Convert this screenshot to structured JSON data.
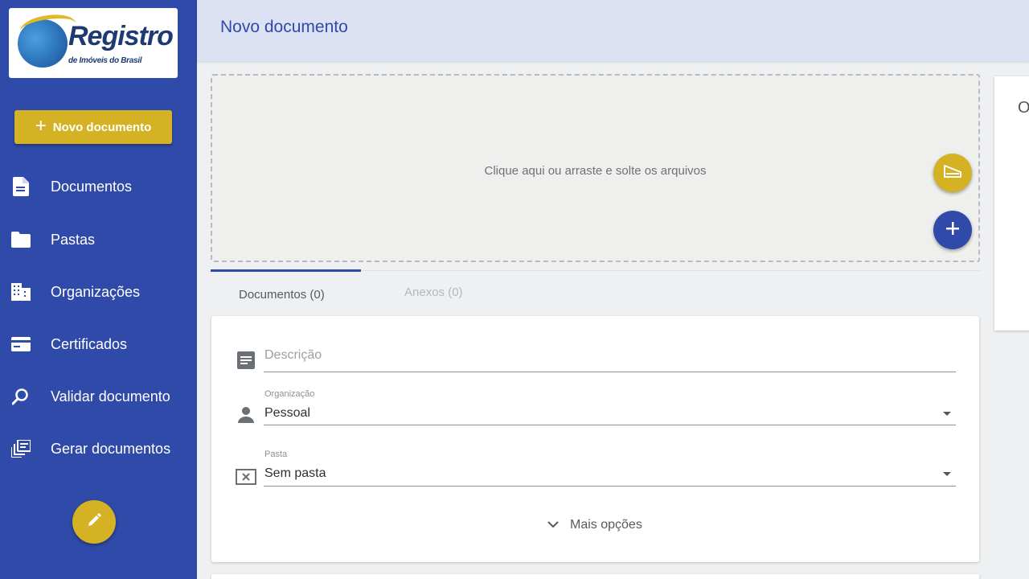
{
  "logo": {
    "title": "Registro",
    "subtitle": "de Imóveis do Brasil"
  },
  "sidebar": {
    "new_button_label": "Novo documento",
    "items": [
      {
        "label": "Documentos",
        "icon": "document-icon"
      },
      {
        "label": "Pastas",
        "icon": "folder-icon"
      },
      {
        "label": "Organizações",
        "icon": "building-icon"
      },
      {
        "label": "Certificados",
        "icon": "card-icon"
      },
      {
        "label": "Validar documento",
        "icon": "search-zoom-icon"
      },
      {
        "label": "Gerar documentos",
        "icon": "generate-documents-icon"
      }
    ]
  },
  "header": {
    "title": "Novo documento"
  },
  "dropzone": {
    "text": "Clique aqui ou arraste e solte os arquivos"
  },
  "right_panel": {
    "text": "O"
  },
  "tabs": [
    {
      "label": "Documentos (0)",
      "active": true
    },
    {
      "label": "Anexos (0)",
      "active": false
    }
  ],
  "form": {
    "description_placeholder": "Descrição",
    "organization_label": "Organização",
    "organization_value": "Pessoal",
    "folder_label": "Pasta",
    "folder_value": "Sem pasta",
    "more_options": "Mais opções"
  },
  "colors": {
    "primary": "#2f4aa8",
    "accent": "#d4b223",
    "header_bg": "#dde1f4"
  }
}
